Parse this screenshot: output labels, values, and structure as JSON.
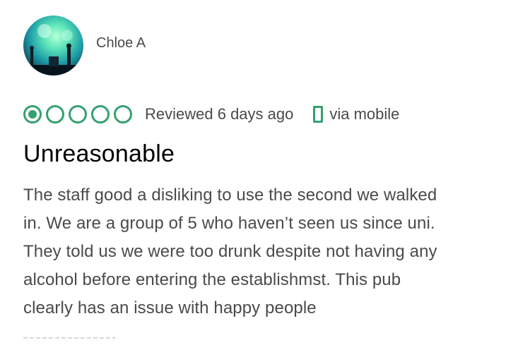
{
  "reviewer": {
    "name": "Chloe A",
    "avatar_icon": "concert-photo-avatar"
  },
  "rating": {
    "value": 1,
    "max": 5,
    "color": "#34a06f"
  },
  "meta": {
    "review_date": "Reviewed 6 days ago",
    "device_icon": "mobile-phone-icon",
    "device": "via mobile"
  },
  "review": {
    "title": "Unreasonable",
    "body_lines": [
      "The staff good a disliking to use the second we walked",
      "in. We are a group of 5 who haven’t seen us since uni.",
      "They told us we were too drunk despite not having any",
      "alcohol before entering the establishmst. This pub",
      "clearly has an issue with happy people"
    ]
  }
}
